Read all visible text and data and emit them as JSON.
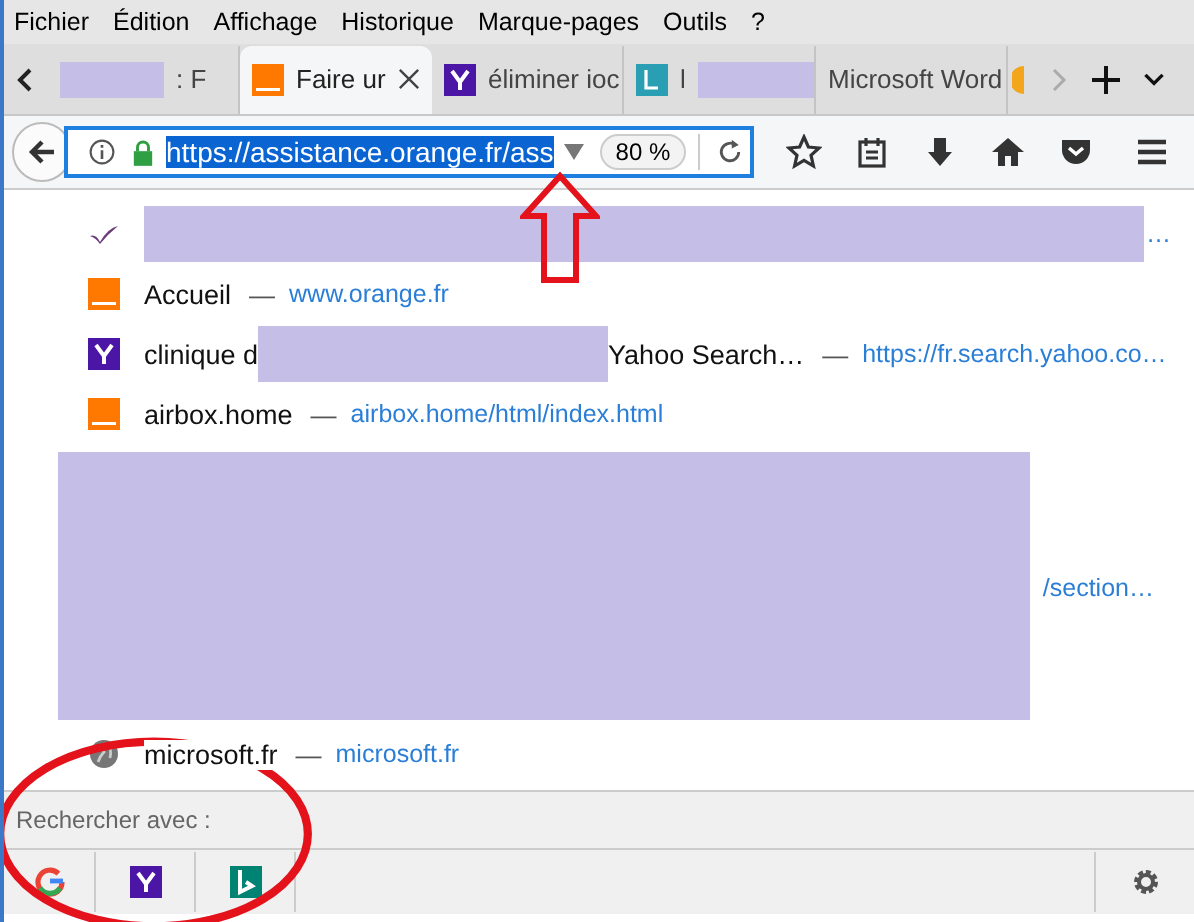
{
  "menu": [
    "Fichier",
    "Édition",
    "Affichage",
    "Historique",
    "Marque-pages",
    "Outils",
    "?"
  ],
  "tabs": [
    {
      "title": ": F",
      "selected": false
    },
    {
      "title": "Faire ur",
      "selected": true
    },
    {
      "title": "éliminer ioc",
      "selected": false
    },
    {
      "title": "l",
      "selected": false
    },
    {
      "title": "Microsoft Word",
      "selected": false
    },
    {
      "selected": false
    }
  ],
  "address": {
    "url": "https://assistance.orange.fr/ass",
    "selected": true,
    "zoom": "80 %"
  },
  "results": [
    {
      "kind": "row",
      "parts": [
        {
          "kind": "redacted"
        }
      ],
      "url": "…"
    },
    {
      "kind": "row",
      "parts": [
        {
          "kind": "text",
          "text": "Accueil"
        }
      ],
      "separator": "—",
      "url": "www.orange.fr"
    },
    {
      "kind": "row",
      "parts": [
        {
          "kind": "text",
          "text": "clinique d"
        },
        {
          "kind": "redacted"
        },
        {
          "kind": "text",
          "text": "Yahoo Search…"
        }
      ],
      "separator": "—",
      "url": "https://fr.search.yahoo.co…"
    },
    {
      "kind": "row",
      "parts": [
        {
          "kind": "text",
          "text": "airbox.home"
        }
      ],
      "separator": "—",
      "url": "airbox.home/html/index.html"
    },
    {
      "kind": "redacted_block",
      "url": "/section…"
    },
    {
      "kind": "row",
      "parts": [
        {
          "kind": "text",
          "text": "microsoft.fr"
        }
      ],
      "separator": "—",
      "url": "microsoft.fr"
    }
  ],
  "search_with": {
    "label": "Rechercher avec :",
    "engines": [
      {
        "kind": "google"
      },
      {
        "kind": "yahoo"
      },
      {
        "kind": "bing"
      }
    ]
  }
}
